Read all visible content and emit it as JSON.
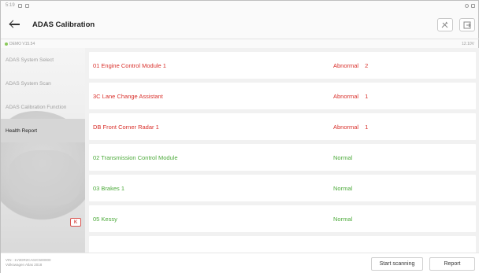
{
  "statusbar": {
    "time": "5:19"
  },
  "header": {
    "title": "ADAS Calibration",
    "buttons": [
      {
        "icon": "tools-icon"
      },
      {
        "icon": "exit-icon"
      }
    ]
  },
  "subheader": {
    "version": "DEMO V15.54",
    "voltage": "12.10V"
  },
  "sidebar": {
    "items": [
      {
        "label": "ADAS System Select",
        "active": false
      },
      {
        "label": "ADAS System Scan",
        "active": false
      },
      {
        "label": "ADAS Calibration Function",
        "active": false
      },
      {
        "label": "Health Report",
        "active": true
      }
    ],
    "collapse_label": "K"
  },
  "modules": [
    {
      "name": "01 Engine Control Module 1",
      "status": "Abnormal",
      "count": "2",
      "state": "abnormal"
    },
    {
      "name": "3C Lane Change Assistant",
      "status": "Abnormal",
      "count": "1",
      "state": "abnormal"
    },
    {
      "name": "DB Front Corner Radar 1",
      "status": "Abnormal",
      "count": "1",
      "state": "abnormal"
    },
    {
      "name": "02 Transmission Control Module",
      "status": "Normal",
      "count": "",
      "state": "normal"
    },
    {
      "name": "03 Brakes 1",
      "status": "Normal",
      "count": "",
      "state": "normal"
    },
    {
      "name": "05 Kessy",
      "status": "Normal",
      "count": "",
      "state": "normal"
    },
    {
      "name": "",
      "status": "",
      "count": "",
      "state": "normal"
    }
  ],
  "footer": {
    "vin": "VIN : 1V2DR2CA0JC500000",
    "vehicle": "Volkswagen Atlas 2018",
    "start_scanning": "Start scanning",
    "report": "Report"
  }
}
